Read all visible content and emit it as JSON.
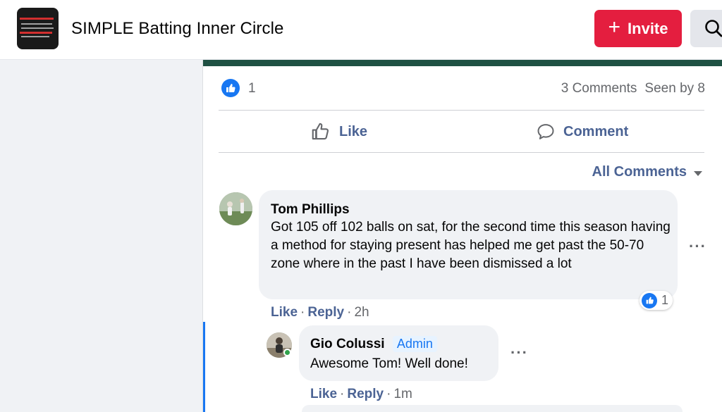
{
  "header": {
    "group_title": "SIMPLE Batting Inner Circle",
    "invite_label": "Invite",
    "icons": {
      "invite": "plus-icon",
      "search": "search-icon"
    }
  },
  "post": {
    "like_count": "1",
    "comments_count": "3 Comments",
    "seen_by": "Seen by 8",
    "like_label": "Like",
    "comment_label": "Comment",
    "all_comments_label": "All Comments"
  },
  "comments": [
    {
      "author": "Tom Phillips",
      "text": "Got 105 off 102 balls on sat, for the second time this season having a method for staying present has helped me get past the 50-70 zone where in the past I have been dismissed a lot",
      "like": "Like",
      "reply": "Reply",
      "time": "2h",
      "reaction_count": "1",
      "more": "···"
    }
  ],
  "replies": [
    {
      "author": "Gio Colussi",
      "badge": "Admin",
      "text": "Awesome Tom! Well done!",
      "like": "Like",
      "reply": "Reply",
      "time": "1m",
      "more": "···"
    }
  ],
  "colors": {
    "accent": "#1877f2",
    "invite": "#e41e3f",
    "group_bar": "#1f5143",
    "link_text": "#4b6394"
  }
}
